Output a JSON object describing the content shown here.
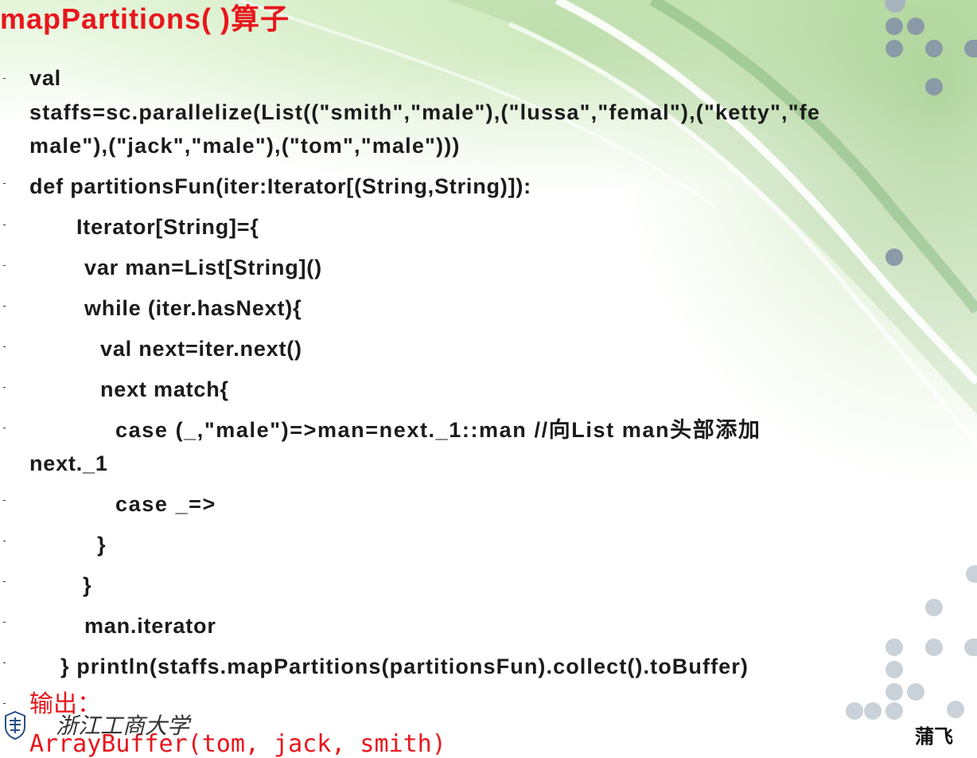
{
  "slide": {
    "title": "mapPartitions( )算子",
    "code_lines": [
      "val",
      "staffs=sc.parallelize(List((\"smith\",\"male\"),(\"lussa\",\"femal\"),(\"ketty\",\"fe",
      "male\"),(\"jack\",\"male\"),(\"tom\",\"male\")))",
      "def partitionsFun(iter:Iterator[(String,String)]):",
      "Iterator[String]={",
      "var man=List[String]()",
      "while (iter.hasNext){",
      "val next=iter.next()",
      "next match{",
      "case (_,\"male\")=>man=next._1::man //向List    man头部添加",
      "next._1",
      "case _=>",
      "}",
      "}",
      "man.iterator",
      "}    println(staffs.mapPartitions(partitionsFun).collect().toBuffer)"
    ],
    "output_label": "输出：",
    "output_value": "ArrayBuffer(tom, jack, smith)"
  },
  "footer": {
    "university": "浙江工商大学",
    "author": "蒲飞"
  },
  "colors": {
    "title": "#e8161c",
    "code": "#1b1b1b",
    "output": "#e8161c",
    "accent_green": "#8fc46e",
    "dot_grey": "#8a9aa6"
  }
}
